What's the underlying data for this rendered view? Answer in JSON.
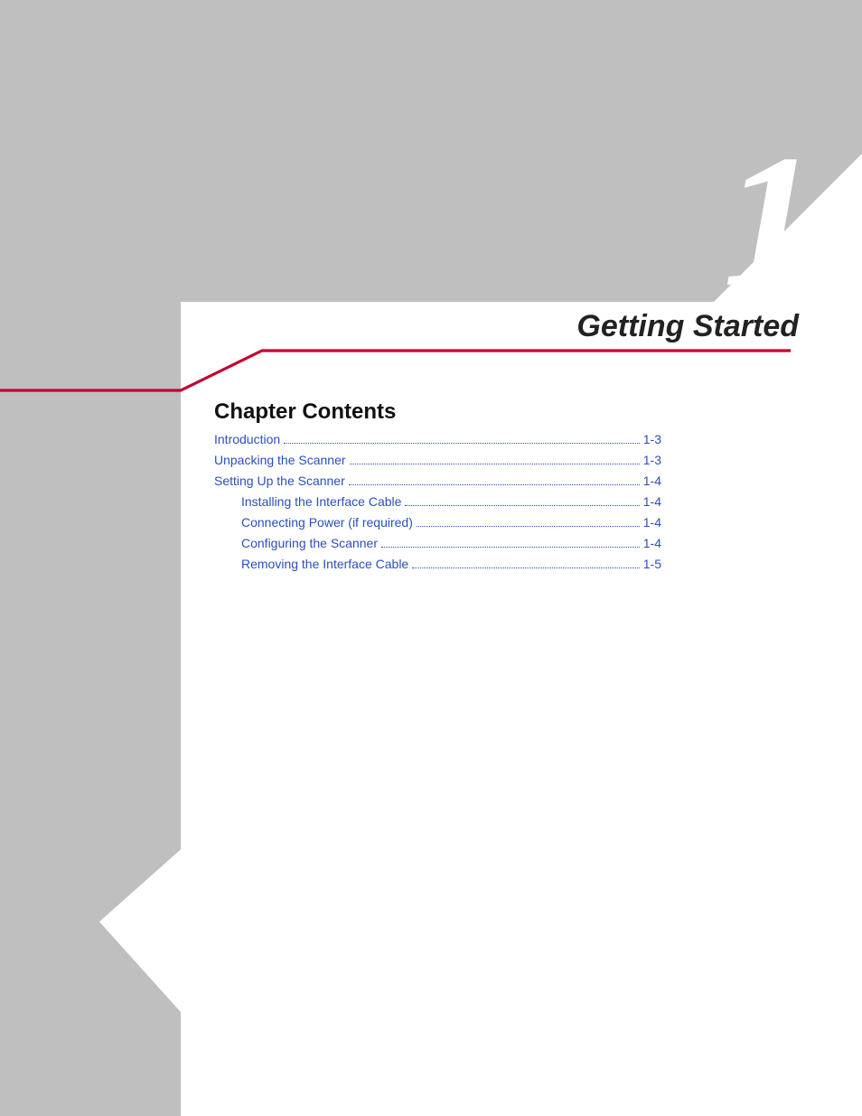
{
  "chapter": {
    "number": "1",
    "title": "Getting Started",
    "section_heading": "Chapter Contents"
  },
  "toc": [
    {
      "label": "Introduction",
      "page": "1-3",
      "level": 0
    },
    {
      "label": "Unpacking the Scanner",
      "page": "1-3",
      "level": 0
    },
    {
      "label": "Setting Up the Scanner",
      "page": "1-4",
      "level": 0
    },
    {
      "label": "Installing the Interface Cable",
      "page": "1-4",
      "level": 1
    },
    {
      "label": "Connecting Power (if required)",
      "page": "1-4",
      "level": 1
    },
    {
      "label": "Configuring the Scanner",
      "page": "1-4",
      "level": 1
    },
    {
      "label": "Removing the Interface Cable",
      "page": "1-5",
      "level": 1
    }
  ]
}
